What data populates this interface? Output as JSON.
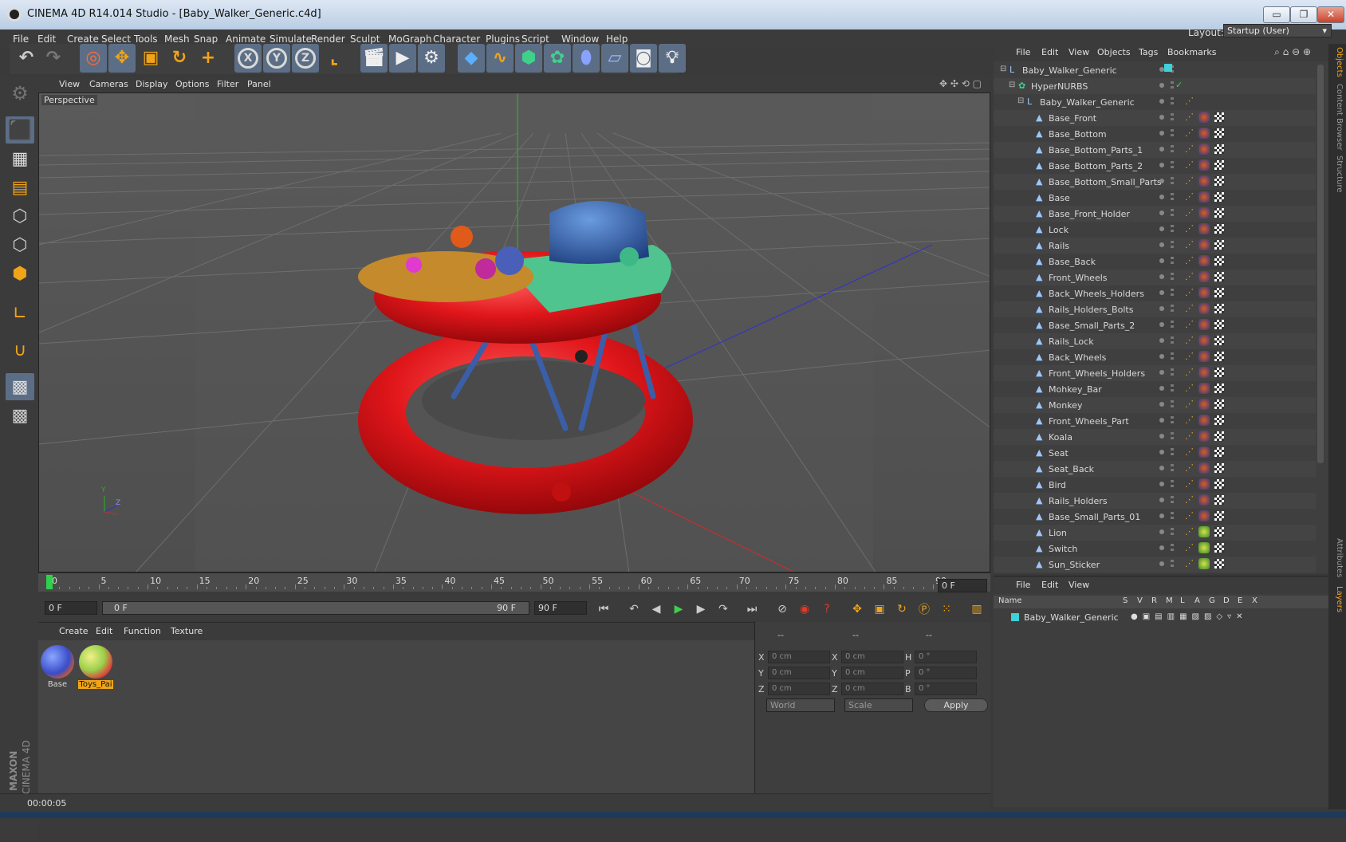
{
  "window": {
    "title": "CINEMA 4D R14.014 Studio - [Baby_Walker_Generic.c4d]",
    "controls": {
      "minimize": "▭",
      "maximize": "❐",
      "close": "✕"
    }
  },
  "menu": [
    "File",
    "Edit",
    "Create",
    "Select",
    "Tools",
    "Mesh",
    "Snap",
    "Animate",
    "Simulate",
    "Render",
    "Sculpt",
    "MoGraph",
    "Character",
    "Plugins",
    "Script",
    "Window",
    "Help"
  ],
  "layout": {
    "label": "Layout:",
    "value": "Startup (User)"
  },
  "toolbar": {
    "axis_x": "X",
    "axis_y": "Y",
    "axis_z": "Z"
  },
  "viewport": {
    "menu": [
      "View",
      "Cameras",
      "Display",
      "Options",
      "Filter",
      "Panel"
    ],
    "label": "Perspective",
    "axis_y": "Y",
    "axis_z": "Z"
  },
  "timeline": {
    "ticks": [
      "0",
      "5",
      "10",
      "15",
      "20",
      "25",
      "30",
      "35",
      "40",
      "45",
      "50",
      "55",
      "60",
      "65",
      "70",
      "75",
      "80",
      "85",
      "90"
    ],
    "current_frame": "0 F"
  },
  "playback": {
    "start": "0 F",
    "range_start": "0 F",
    "range_end": "90 F",
    "end": "90 F"
  },
  "materials": {
    "menu": [
      "Create",
      "Edit",
      "Function",
      "Texture"
    ],
    "items": [
      {
        "name": "Base",
        "selected": false
      },
      {
        "name": "Toys_Pai",
        "selected": true
      }
    ]
  },
  "coordinates": {
    "headers": [
      "--",
      "--",
      "--"
    ],
    "rows": [
      {
        "l1": "X",
        "v1": "0 cm",
        "l2": "X",
        "v2": "0 cm",
        "l3": "H",
        "v3": "0 °"
      },
      {
        "l1": "Y",
        "v1": "0 cm",
        "l2": "Y",
        "v2": "0 cm",
        "l3": "P",
        "v3": "0 °"
      },
      {
        "l1": "Z",
        "v1": "0 cm",
        "l2": "Z",
        "v2": "0 cm",
        "l3": "B",
        "v3": "0 °"
      }
    ],
    "mode": "World",
    "scale": "Scale",
    "apply": "Apply"
  },
  "status": {
    "time": "00:00:05"
  },
  "brand": {
    "maker": "MAXON",
    "product": "CINEMA 4D"
  },
  "objects": {
    "menu": [
      "File",
      "Edit",
      "View",
      "Objects",
      "Tags",
      "Bookmarks"
    ],
    "items": [
      {
        "name": "Baby_Walker_Generic",
        "level": 0,
        "type": "null"
      },
      {
        "name": "HyperNURBS",
        "level": 1,
        "type": "nurbs"
      },
      {
        "name": "Baby_Walker_Generic",
        "level": 2,
        "type": "null"
      },
      {
        "name": "Base_Front",
        "level": 3,
        "type": "poly"
      },
      {
        "name": "Base_Bottom",
        "level": 3,
        "type": "poly"
      },
      {
        "name": "Base_Bottom_Parts_1",
        "level": 3,
        "type": "poly"
      },
      {
        "name": "Base_Bottom_Parts_2",
        "level": 3,
        "type": "poly"
      },
      {
        "name": "Base_Bottom_Small_Parts",
        "level": 3,
        "type": "poly"
      },
      {
        "name": "Base",
        "level": 3,
        "type": "poly"
      },
      {
        "name": "Base_Front_Holder",
        "level": 3,
        "type": "poly"
      },
      {
        "name": "Lock",
        "level": 3,
        "type": "poly"
      },
      {
        "name": "Rails",
        "level": 3,
        "type": "poly"
      },
      {
        "name": "Base_Back",
        "level": 3,
        "type": "poly"
      },
      {
        "name": "Front_Wheels",
        "level": 3,
        "type": "poly"
      },
      {
        "name": "Back_Wheels_Holders",
        "level": 3,
        "type": "poly"
      },
      {
        "name": "Rails_Holders_Bolts",
        "level": 3,
        "type": "poly"
      },
      {
        "name": "Base_Small_Parts_2",
        "level": 3,
        "type": "poly"
      },
      {
        "name": "Rails_Lock",
        "level": 3,
        "type": "poly"
      },
      {
        "name": "Back_Wheels",
        "level": 3,
        "type": "poly"
      },
      {
        "name": "Front_Wheels_Holders",
        "level": 3,
        "type": "poly"
      },
      {
        "name": "Mohkey_Bar",
        "level": 3,
        "type": "poly"
      },
      {
        "name": "Monkey",
        "level": 3,
        "type": "poly"
      },
      {
        "name": "Front_Wheels_Part",
        "level": 3,
        "type": "poly"
      },
      {
        "name": "Koala",
        "level": 3,
        "type": "poly"
      },
      {
        "name": "Seat",
        "level": 3,
        "type": "poly"
      },
      {
        "name": "Seat_Back",
        "level": 3,
        "type": "poly"
      },
      {
        "name": "Bird",
        "level": 3,
        "type": "poly"
      },
      {
        "name": "Rails_Holders",
        "level": 3,
        "type": "poly"
      },
      {
        "name": "Base_Small_Parts_01",
        "level": 3,
        "type": "poly"
      },
      {
        "name": "Lion",
        "level": 3,
        "type": "poly"
      },
      {
        "name": "Switch",
        "level": 3,
        "type": "poly"
      },
      {
        "name": "Sun_Sticker",
        "level": 3,
        "type": "poly"
      }
    ]
  },
  "side_tabs": [
    "Objects",
    "Content Browser",
    "Structure",
    "Attributes",
    "Layers"
  ],
  "layers": {
    "menu": [
      "File",
      "Edit",
      "View"
    ],
    "columns": [
      "Name",
      "S",
      "V",
      "R",
      "M",
      "L",
      "A",
      "G",
      "D",
      "E",
      "X"
    ],
    "items": [
      {
        "name": "Baby_Walker_Generic",
        "color": "#3fd0d8"
      }
    ]
  },
  "colors": {
    "accent": "#5c6e86",
    "walker_red": "#e0161a",
    "seat_blue": "#2f5fa8",
    "tray_green": "#4fc48e"
  }
}
